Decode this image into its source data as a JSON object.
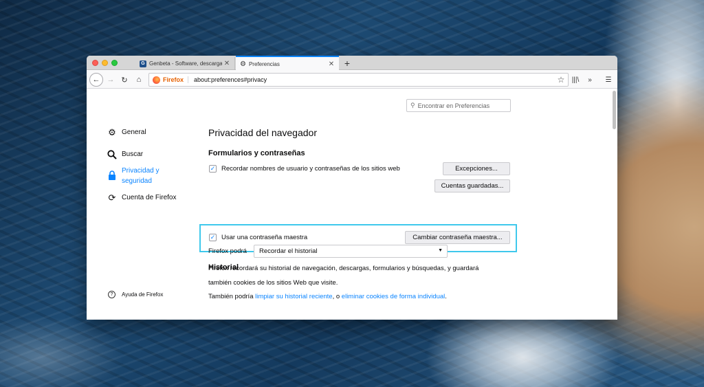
{
  "tabs": [
    {
      "title": "Genbeta - Software, descargas",
      "favicon": "G"
    },
    {
      "title": "Preferencias"
    }
  ],
  "urlbar": {
    "identity": "Firefox",
    "url": "about:preferences#privacy"
  },
  "search": {
    "placeholder": "Encontrar en Preferencias"
  },
  "sidebar": {
    "items": [
      {
        "label": "General",
        "icon": "gear-icon"
      },
      {
        "label": "Buscar",
        "icon": "search-icon"
      },
      {
        "label": "Privacidad y seguridad",
        "icon": "lock-icon",
        "active": true
      },
      {
        "label": "Cuenta de Firefox",
        "icon": "sync-icon"
      }
    ],
    "help": "Ayuda de Firefox"
  },
  "main": {
    "title": "Privacidad del navegador",
    "forms": {
      "heading": "Formularios y contraseñas",
      "remember_label": "Recordar nombres de usuario y contraseñas de los sitios web",
      "exceptions_button": "Excepciones...",
      "saved_logins_button": "Cuentas guardadas...",
      "master_password_label": "Usar una contraseña maestra",
      "change_master_button": "Cambiar contraseña maestra..."
    },
    "history": {
      "heading": "Historial",
      "firefox_will": "Firefox podrá",
      "mode": "Recordar el historial",
      "desc_line1": "Firefox recordará su historial de navegación, descargas, formularios y búsquedas, y guardará",
      "desc_line2": "también cookies de los sitios Web que visite.",
      "also_prefix": "También podría ",
      "clear_link": "limpiar su historial reciente",
      "or_text": ", o ",
      "remove_cookies_link": "eliminar cookies de forma individual",
      "period": "."
    }
  },
  "colors": {
    "accent": "#0a84ff",
    "highlight": "#3ec8ec"
  }
}
